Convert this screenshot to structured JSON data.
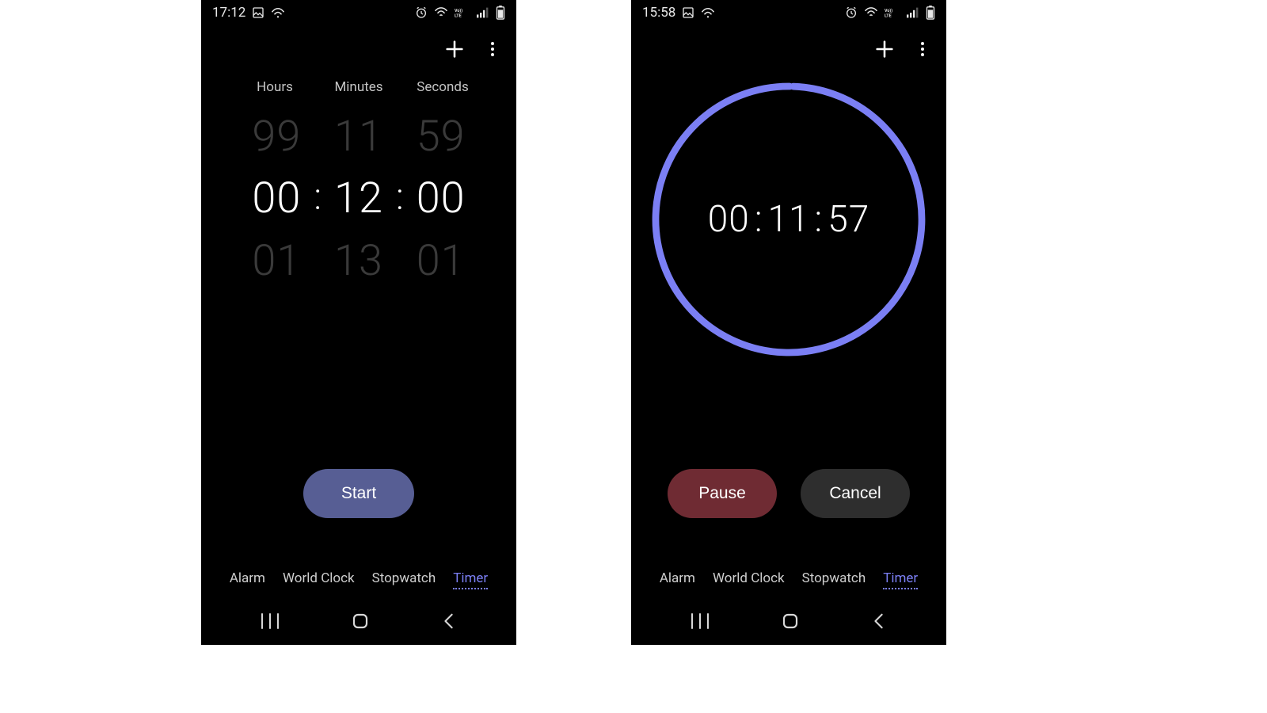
{
  "left": {
    "status": {
      "time": "17:12"
    },
    "picker": {
      "labels": {
        "hours": "Hours",
        "minutes": "Minutes",
        "seconds": "Seconds"
      },
      "hours": {
        "prev": "99",
        "cur": "00",
        "next": "01"
      },
      "minutes": {
        "prev": "11",
        "cur": "12",
        "next": "13"
      },
      "seconds": {
        "prev": "59",
        "cur": "00",
        "next": "01"
      }
    },
    "buttons": {
      "start": "Start"
    }
  },
  "right": {
    "status": {
      "time": "15:58"
    },
    "timer": {
      "hours": "00",
      "minutes": "11",
      "seconds": "57"
    },
    "buttons": {
      "pause": "Pause",
      "cancel": "Cancel"
    }
  },
  "tabs": {
    "alarm": "Alarm",
    "worldclock": "World Clock",
    "stopwatch": "Stopwatch",
    "timer": "Timer"
  },
  "colors": {
    "accent": "#7b7ff4"
  }
}
